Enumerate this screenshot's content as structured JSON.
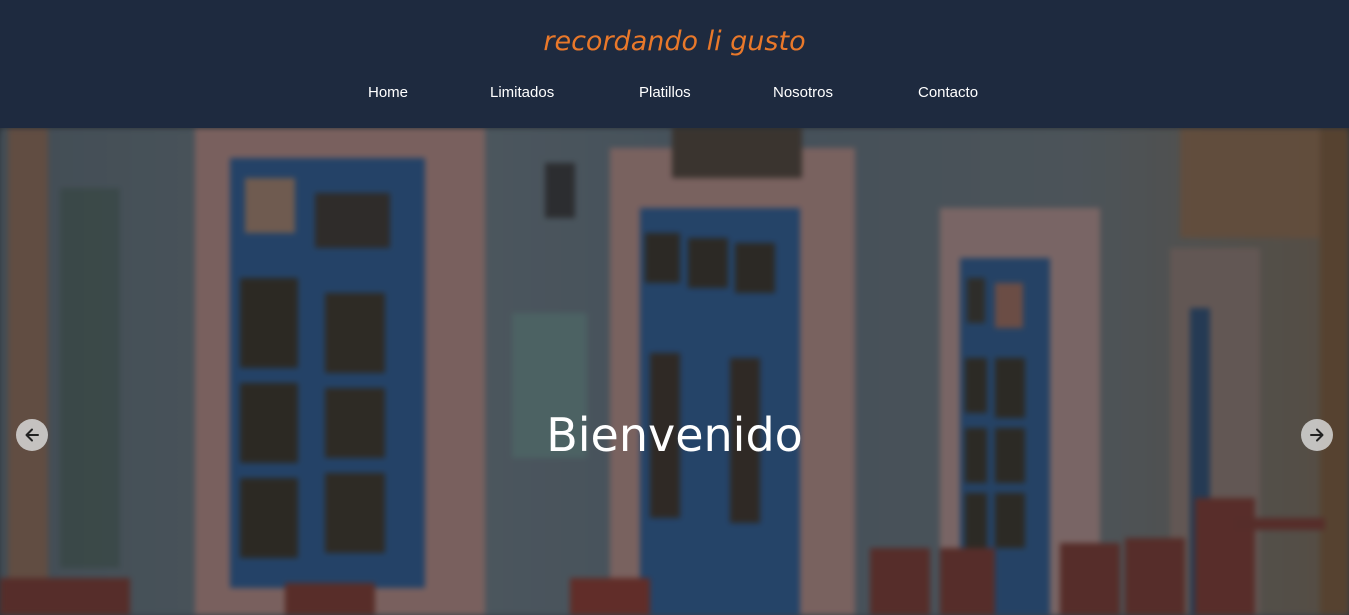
{
  "header": {
    "brand": "recordando li gusto",
    "nav": [
      {
        "label": "Home"
      },
      {
        "label": "Limitados"
      },
      {
        "label": "Platillos"
      },
      {
        "label": "Nosotros"
      },
      {
        "label": "Contacto"
      }
    ]
  },
  "hero": {
    "title": "Bienvenido",
    "prev_icon": "arrow-left-icon",
    "next_icon": "arrow-right-icon"
  },
  "colors": {
    "header_bg": "#1e2a3f",
    "brand": "#e9782a",
    "nav_text": "#ffffff"
  }
}
